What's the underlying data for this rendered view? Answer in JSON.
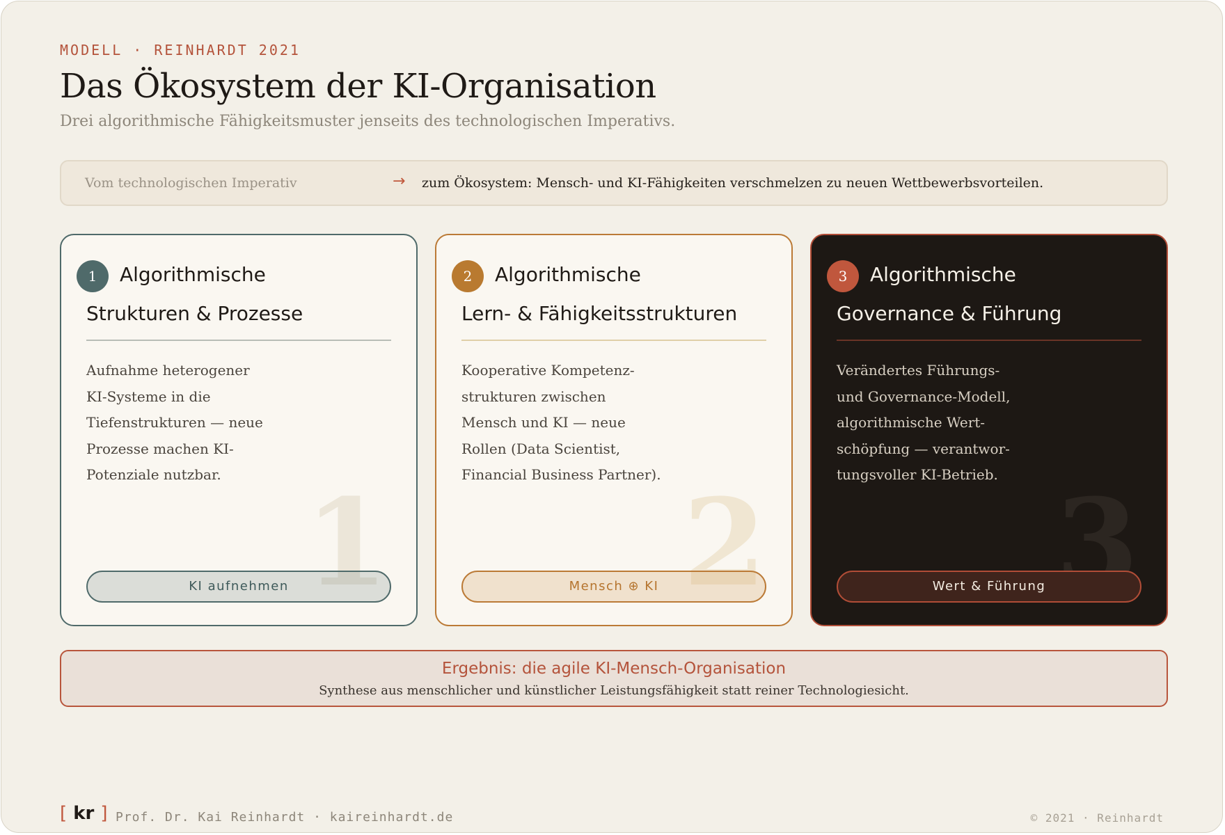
{
  "header": {
    "eyebrow": "MODELL · REINHARDT 2021",
    "title": "Das Ökosystem der KI-Organisation",
    "subtitle": "Drei algorithmische Fähigkeitsmuster jenseits des technologischen Imperativs."
  },
  "banner": {
    "from": "Vom technologischen Imperativ",
    "arrow": "→",
    "to": "zum Ökosystem: Mensch- und KI-Fähigkeiten verschmelzen zu neuen Wettbewerbsvorteilen."
  },
  "cards": [
    {
      "number": "1",
      "title_line1": "Algorithmische",
      "title_line2": "Strukturen & Prozesse",
      "body": "Aufnahme heterogener\nKI-Systeme in die\nTiefenstrukturen — neue\nProzesse machen KI-\nPotenziale nutzbar.",
      "watermark": "1",
      "pill": "KI aufnehmen",
      "color": "#4f6a6a"
    },
    {
      "number": "2",
      "title_line1": "Algorithmische",
      "title_line2": "Lern- & Fähigkeitsstrukturen",
      "body": "Kooperative Kompetenz-\nstrukturen zwischen\nMensch und KI — neue\nRollen (Data Scientist,\nFinancial Business Partner).",
      "watermark": "2",
      "pill": "Mensch ⊕ KI",
      "color": "#bb7a36"
    },
    {
      "number": "3",
      "title_line1": "Algorithmische",
      "title_line2": "Governance & Führung",
      "body": "Verändertes Führungs-\nund Governance-Modell,\nalgorithmische Wert-\nschöpfung — verantwor-\ntungsvoller KI-Betrieb.",
      "watermark": "3",
      "pill": "Wert & Führung",
      "color": "#b14d37"
    }
  ],
  "result": {
    "title": "Ergebnis: die agile KI-Mensch-Organisation",
    "text": "Synthese aus menschlicher und künstlicher Leistungsfähigkeit statt reiner Technologiesicht."
  },
  "footer": {
    "logo_open": "[",
    "logo_text": "kr",
    "logo_close": "]",
    "author": "Prof. Dr. Kai Reinhardt · kaireinhardt.de",
    "copyright": "© 2021 · Reinhardt"
  }
}
